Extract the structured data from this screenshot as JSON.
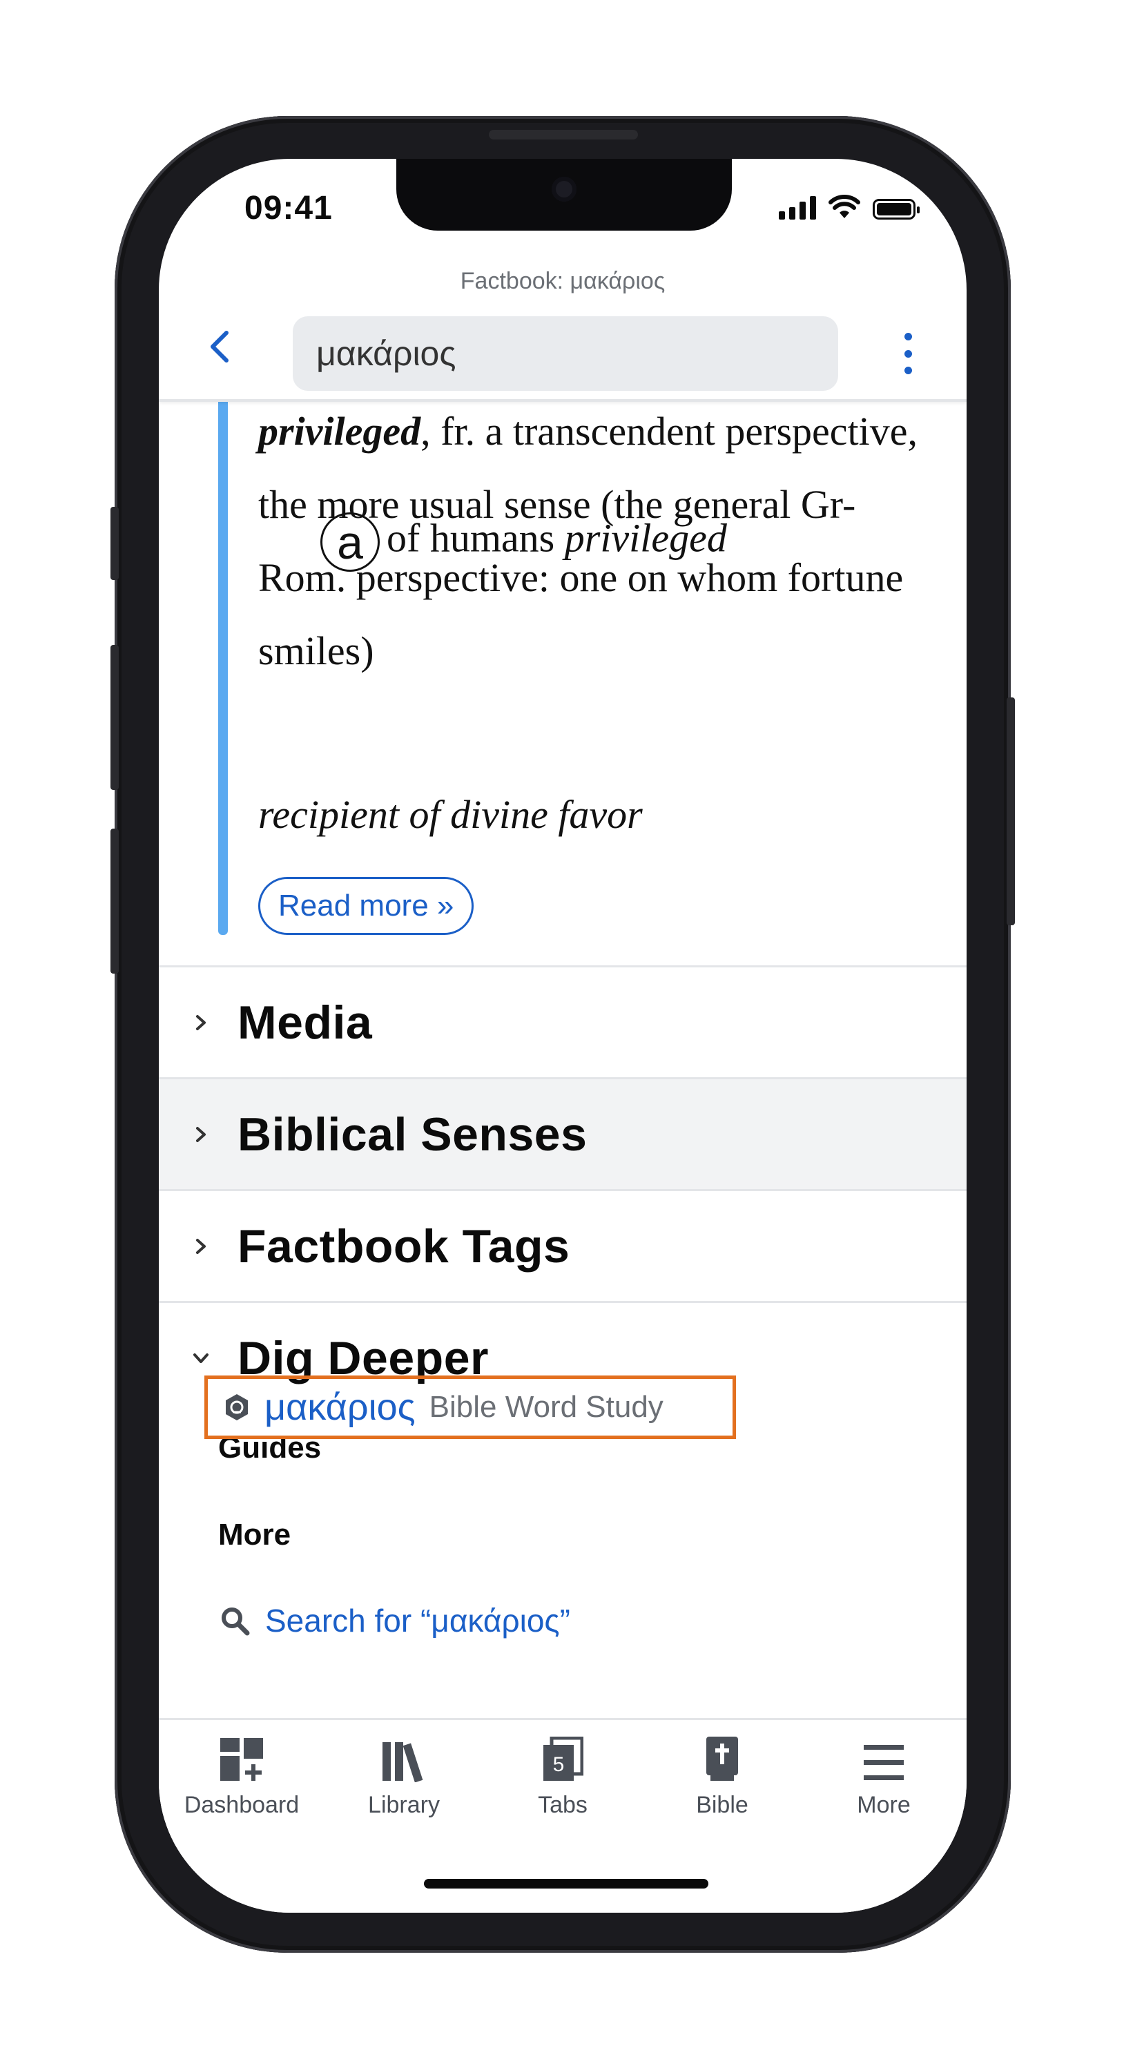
{
  "status": {
    "time": "09:41"
  },
  "header": {
    "subtitle": "Factbook: μακάριος",
    "search_value": "μακάριος"
  },
  "article": {
    "paragraph_bold": "privileged",
    "paragraph_rest": ", fr. a transcendent perspective, the more usual sense (the general Gr-Rom. perspective: one on whom fortune smiles)",
    "item_marker": "a",
    "item_text_plain": "of humans ",
    "item_text_italic_1": "privileged",
    "item_text_italic_2": "recipient of divine favor",
    "read_more": "Read more »"
  },
  "sections": [
    {
      "title": "Media",
      "expanded": false
    },
    {
      "title": "Biblical Senses",
      "expanded": false
    },
    {
      "title": "Factbook Tags",
      "expanded": false
    },
    {
      "title": "Dig Deeper",
      "expanded": true
    }
  ],
  "dig_deeper": {
    "guides_heading": "Guides",
    "guide_word": "μακάριος",
    "guide_type": "Bible Word Study",
    "more_heading": "More",
    "search_link": "Search for “μακάριος”"
  },
  "tabbar": {
    "items": [
      {
        "label": "Dashboard",
        "icon": "dashboard-icon"
      },
      {
        "label": "Library",
        "icon": "library-icon"
      },
      {
        "label": "Tabs",
        "icon": "tabs-icon",
        "badge": "5"
      },
      {
        "label": "Bible",
        "icon": "bible-icon"
      },
      {
        "label": "More",
        "icon": "menu-icon"
      }
    ]
  },
  "colors": {
    "accent": "#1b5fc7",
    "quote_bar": "#5aa9f0",
    "highlight_box": "#e3701f"
  }
}
